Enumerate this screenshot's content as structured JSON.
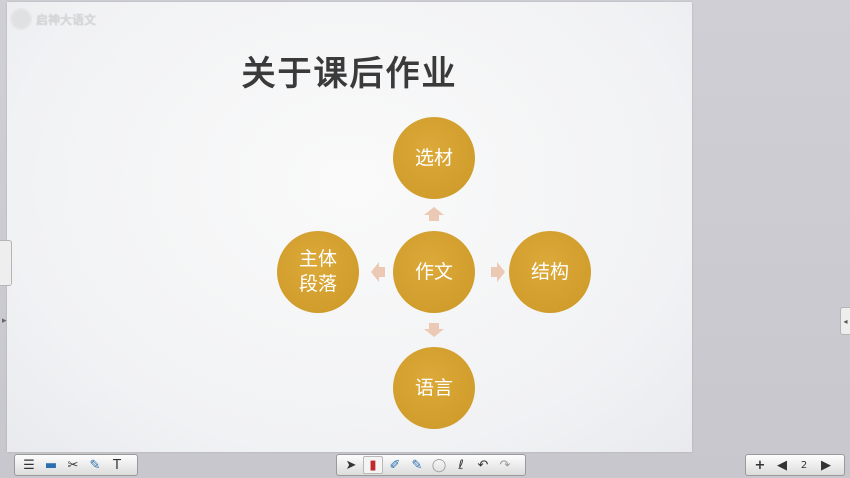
{
  "watermark": {
    "name": "启神大语文"
  },
  "slide": {
    "title": "关于课后作业",
    "center_node": "作文",
    "top_node": "选材",
    "right_node": "结构",
    "bottom_node": "语言",
    "left_node": "主体\n段落",
    "node_color": "#d4a030",
    "arrow_color": "#ecc9b4"
  },
  "toolbars": {
    "left": [
      "menu-icon",
      "screen-icon",
      "tools-icon",
      "pen-icon",
      "text-icon"
    ],
    "center": [
      "pointer-icon",
      "marker-icon",
      "brush-icon",
      "highlighter-icon",
      "eraser-icon",
      "lasso-icon",
      "undo-icon",
      "redo-icon"
    ],
    "right": [
      "add-page-icon",
      "prev-page-icon",
      "page-count-icon",
      "next-page-icon"
    ],
    "page_badge": "2"
  }
}
